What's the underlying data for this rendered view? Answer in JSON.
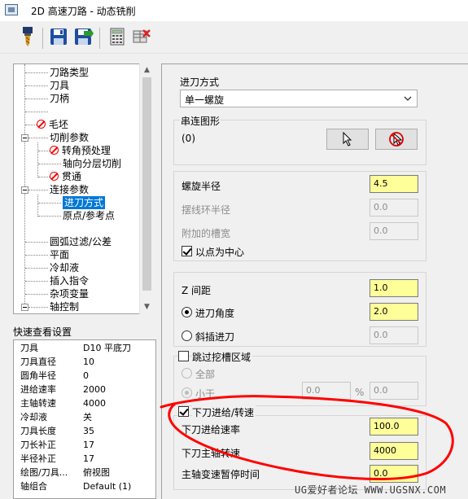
{
  "window": {
    "title": "2D 高速刀路 - 动态铣削"
  },
  "toolbar": {
    "icons": [
      "tool-icon",
      "save-icon",
      "save-as-icon",
      "calculator-icon",
      "delete-icon"
    ]
  },
  "tree": {
    "items": [
      {
        "label": "刀路类型"
      },
      {
        "label": "刀具"
      },
      {
        "label": "刀柄"
      },
      {
        "label": "毛坯"
      },
      {
        "label": "切削参数"
      },
      {
        "label": "转角预处理"
      },
      {
        "label": "轴向分层切削"
      },
      {
        "label": "贯通"
      },
      {
        "label": "连接参数"
      },
      {
        "label": "进刀方式"
      },
      {
        "label": "原点/参考点"
      },
      {
        "label": "圆弧过滤/公差"
      },
      {
        "label": "平面"
      },
      {
        "label": "冷却液"
      },
      {
        "label": "插入指令"
      },
      {
        "label": "杂项变量"
      },
      {
        "label": "轴控制"
      }
    ]
  },
  "quick_view": {
    "title": "快速查看设置",
    "rows": [
      {
        "key": "刀具",
        "value": "D10 平底刀"
      },
      {
        "key": "刀具直径",
        "value": "10"
      },
      {
        "key": "圆角半径",
        "value": "0"
      },
      {
        "key": "进给速率",
        "value": "2000"
      },
      {
        "key": "主轴转速",
        "value": "4000"
      },
      {
        "key": "冷却液",
        "value": "关"
      },
      {
        "key": "刀具长度",
        "value": "35"
      },
      {
        "key": "刀长补正",
        "value": "17"
      },
      {
        "key": "半径补正",
        "value": "17"
      },
      {
        "key": "绘图/刀具...",
        "value": "俯视图"
      },
      {
        "key": "轴组合",
        "value": "Default (1)"
      }
    ]
  },
  "entry": {
    "method_label": "进刀方式",
    "method_value": "单一螺旋",
    "chain_label": "串连图形",
    "chain_count": "(0)",
    "helix_radius_label": "螺旋半径",
    "helix_radius": "4.5",
    "trochoid_radius_label": "摆线环半径",
    "trochoid_radius": "0.0",
    "extra_slot_label": "附加的槽宽",
    "extra_slot": "0.0",
    "center_on_point_label": "以点为中心",
    "z_clearance_label": "Z 间距",
    "z_clearance": "1.0",
    "entry_angle_label": "进刀角度",
    "entry_angle": "2.0",
    "ramp_entry_label": "斜插进刀",
    "ramp_entry": "0.0",
    "skip_slot_label": "跳过挖槽区域",
    "all_label": "全部",
    "less_than_label": "小于",
    "less_than_value": "0.0",
    "percent": "%",
    "less_than_value2": "0.0",
    "plunge_label": "下刀进给/转速",
    "plunge_feed_label": "下刀进给速率",
    "plunge_feed": "100.0",
    "plunge_speed_label": "下刀主轴转速",
    "plunge_speed": "4000",
    "dwell_label": "主轴变速暂停时间",
    "dwell": "0.0"
  },
  "watermark": "UG爱好者论坛 WWW.UGSNX.COM",
  "colors": {
    "highlight_field": "#ffff99",
    "selection": "#0078d7",
    "annotation": "#ff0000"
  }
}
